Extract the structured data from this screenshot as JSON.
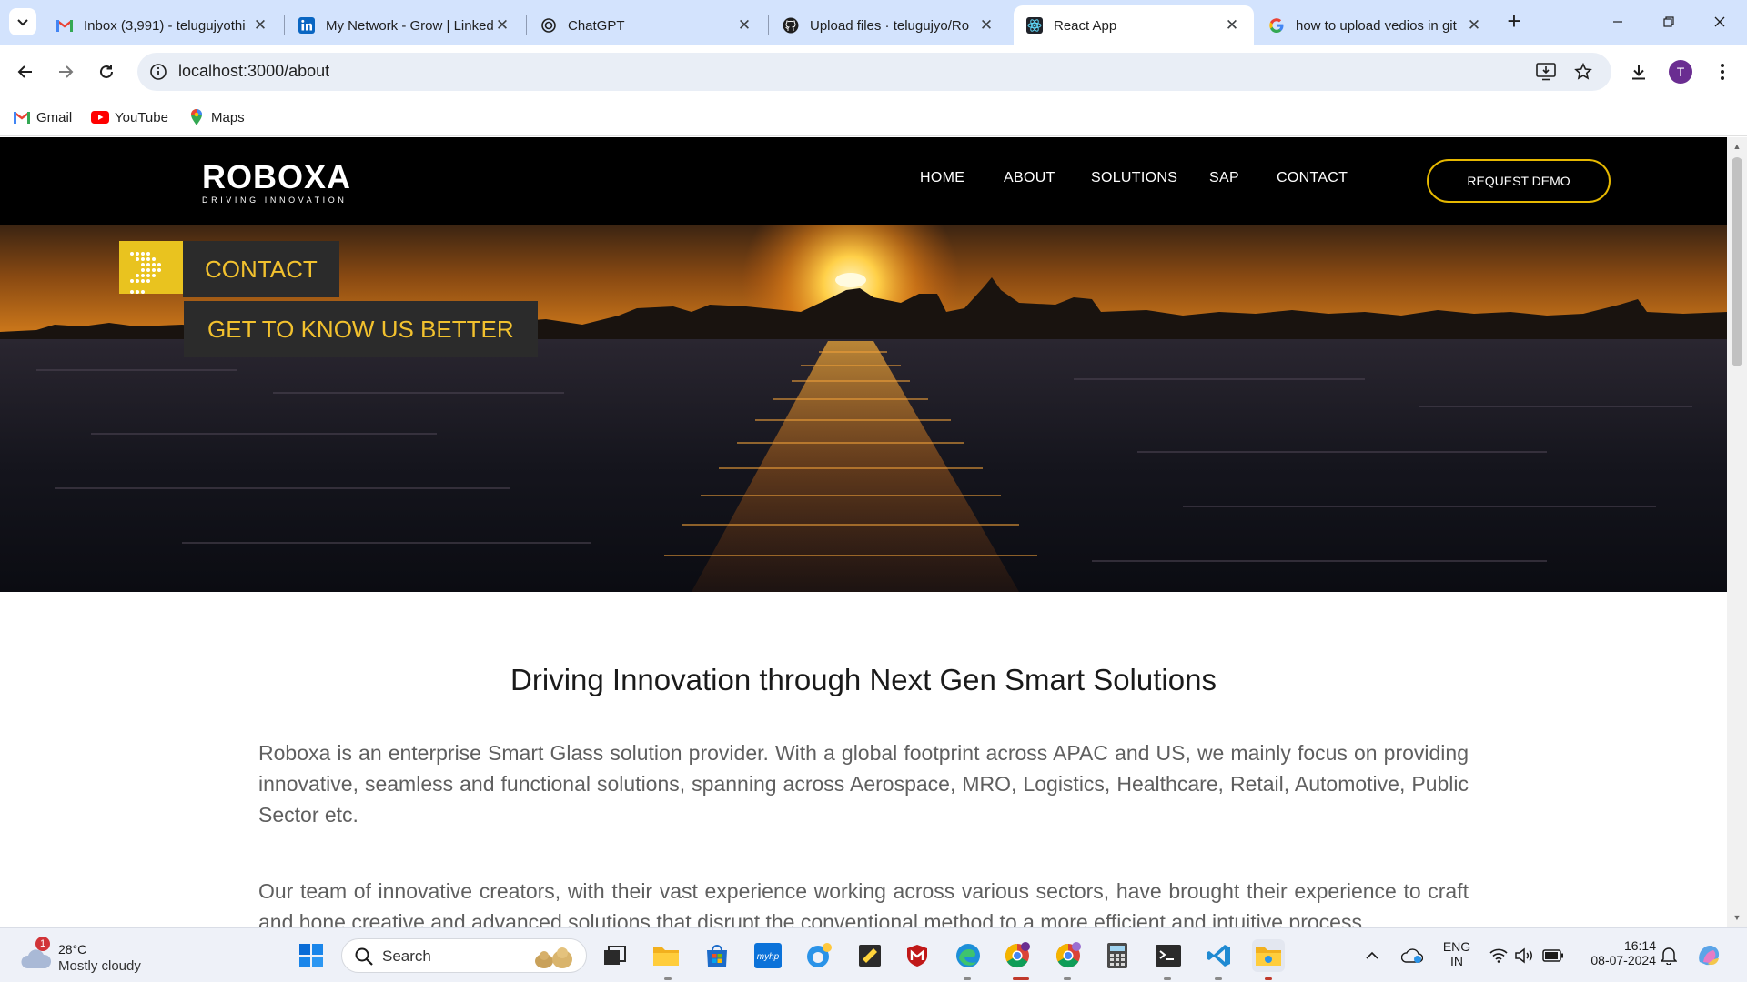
{
  "browser": {
    "tabs": [
      {
        "title": "Inbox (3,991) - telugujyothi",
        "icon": "gmail-icon",
        "active": false
      },
      {
        "title": "My Network - Grow | LinkedIn",
        "icon": "linkedin-icon",
        "active": false
      },
      {
        "title": "ChatGPT",
        "icon": "chatgpt-icon",
        "active": false
      },
      {
        "title": "Upload files · telugujyo/Ro",
        "icon": "github-icon",
        "active": false
      },
      {
        "title": "React App",
        "icon": "react-icon",
        "active": true
      },
      {
        "title": "how to upload vedios in git",
        "icon": "google-icon",
        "active": false
      }
    ],
    "url": "localhost:3000/about",
    "profile_initial": "T",
    "bookmarks": [
      {
        "label": "Gmail",
        "icon": "gmail-icon"
      },
      {
        "label": "YouTube",
        "icon": "youtube-icon"
      },
      {
        "label": "Maps",
        "icon": "maps-icon"
      }
    ]
  },
  "site": {
    "logo_text": "ROBOXA",
    "logo_tagline": "DRIVING INNOVATION",
    "nav": [
      "HOME",
      "ABOUT",
      "SOLUTIONS",
      "SAP",
      "CONTACT"
    ],
    "cta": "REQUEST DEMO",
    "hero_label": "CONTACT",
    "hero_tagline": "GET TO KNOW US BETTER",
    "about_title": "Driving Innovation through Next Gen Smart Solutions",
    "paragraphs": [
      "Roboxa is an enterprise Smart Glass solution provider. With a global footprint across APAC and US, we mainly focus on providing innovative, seamless and functional solutions, spanning across Aerospace, MRO, Logistics, Healthcare, Retail, Automotive, Public Sector etc.",
      "Our team of innovative creators, with their vast experience working across various sectors, have brought their experience to craft and hone creative and advanced solutions that disrupt the conventional method to a more efficient and intuitive process."
    ],
    "colors": {
      "accent": "#e9c31f",
      "header_bg": "#000000",
      "label_text": "#f2c12e"
    }
  },
  "taskbar": {
    "weather_temp": "28°C",
    "weather_desc": "Mostly cloudy",
    "weather_badge": "1",
    "search_placeholder": "Search",
    "lang_1": "ENG",
    "lang_2": "IN",
    "time": "16:14",
    "date": "08-07-2024"
  }
}
